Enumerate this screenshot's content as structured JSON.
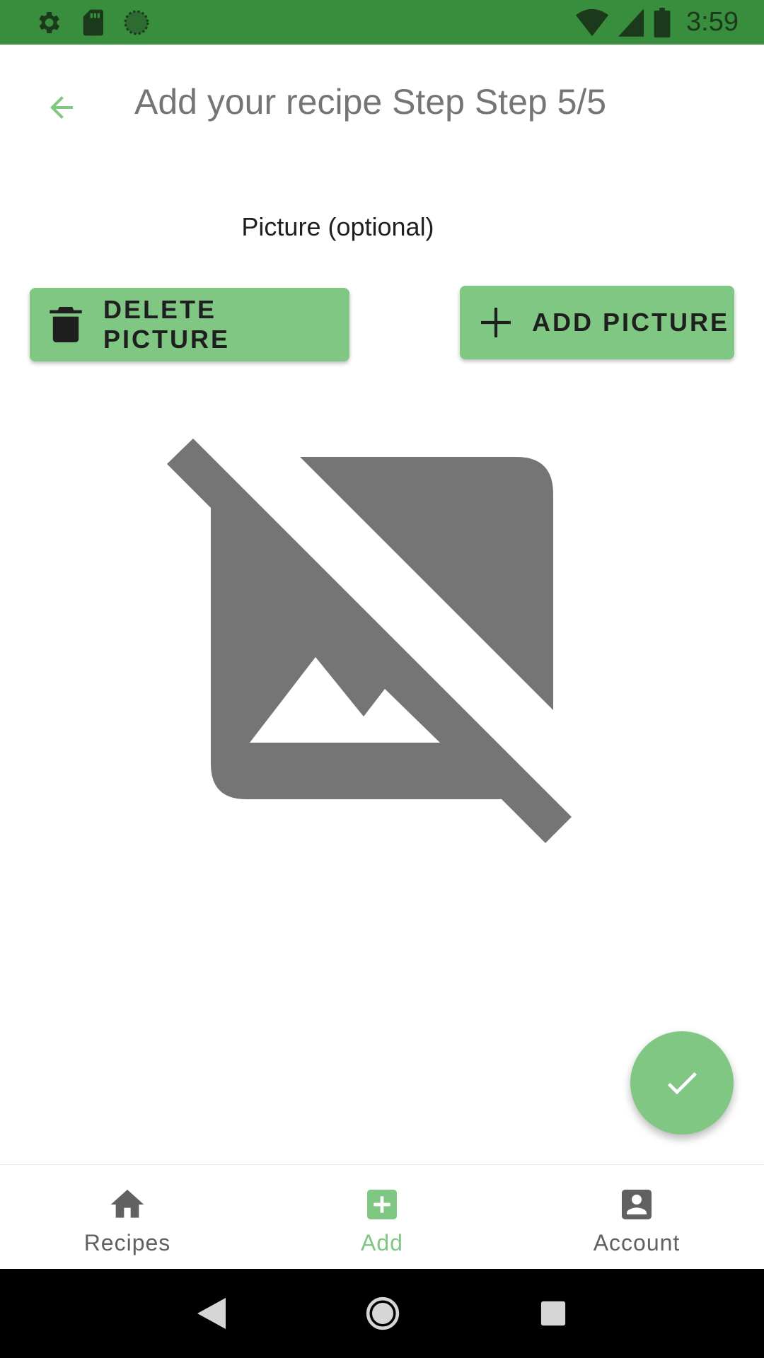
{
  "status_bar": {
    "time": "3:59",
    "icons": [
      "settings-icon",
      "sd-card-icon",
      "sync-icon",
      "wifi-icon",
      "signal-icon",
      "battery-icon"
    ]
  },
  "app_bar": {
    "back_icon": "arrow-back-icon",
    "title": "Add your recipe Step Step 5/5"
  },
  "content": {
    "section_label": "Picture (optional)",
    "delete_button": {
      "label": "DELETE PICTURE",
      "icon": "trash-icon"
    },
    "add_button": {
      "label": "ADD PICTURE",
      "icon": "plus-icon"
    },
    "placeholder_icon": "image-not-supported-icon"
  },
  "fab": {
    "icon": "check-icon"
  },
  "bottom_nav": {
    "items": [
      {
        "label": "Recipes",
        "icon": "home-icon",
        "active": false
      },
      {
        "label": "Add",
        "icon": "add-box-icon",
        "active": true
      },
      {
        "label": "Account",
        "icon": "account-box-icon",
        "active": false
      }
    ]
  },
  "system_nav": {
    "icons": [
      "back-triangle-icon",
      "home-circle-icon",
      "recents-square-icon"
    ]
  },
  "colors": {
    "status_bar": "#388e3c",
    "accent": "#81c784",
    "placeholder_gray": "#757575",
    "system_nav": "#000000"
  }
}
